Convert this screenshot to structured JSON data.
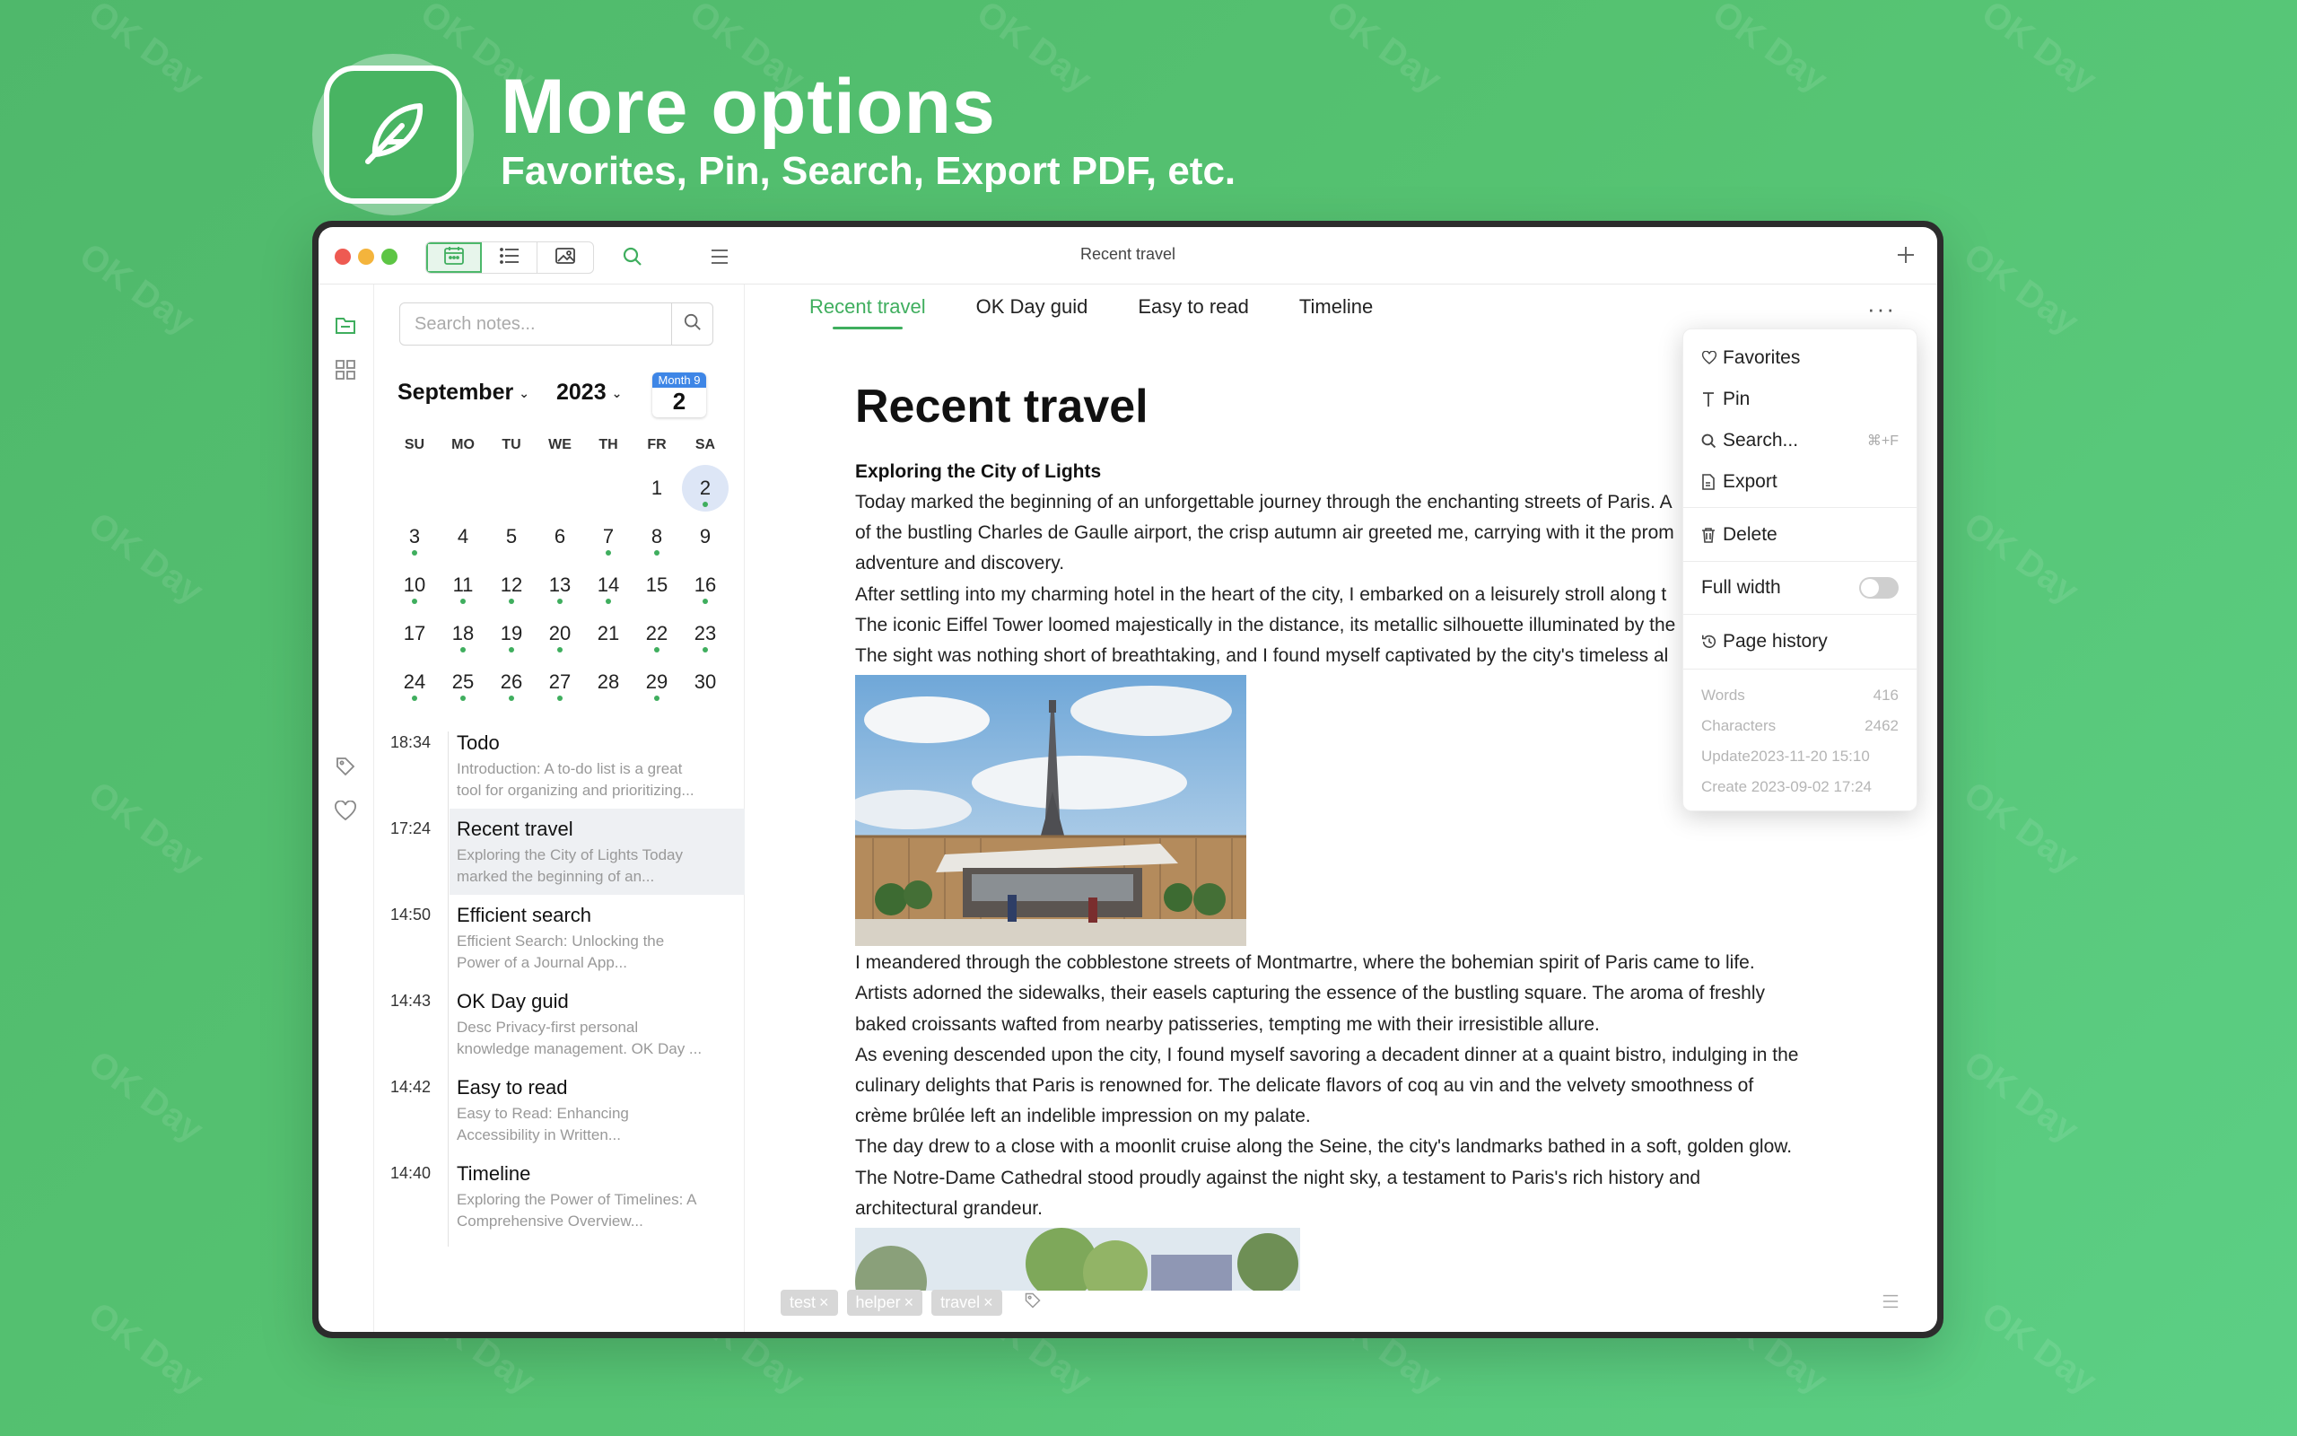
{
  "hero": {
    "title": "More options",
    "subtitle": "Favorites, Pin, Search, Export PDF, etc."
  },
  "watermark": "OK Day",
  "window": {
    "title": "Recent travel",
    "toolbar": {
      "view_calendar": "calendar-view-icon",
      "view_list": "list-view-icon",
      "view_gallery": "gallery-view-icon"
    }
  },
  "sidebar": {
    "search_placeholder": "Search notes...",
    "calendar": {
      "month": "September",
      "year": "2023",
      "today_month": "Month 9",
      "today_day": "2",
      "weekdays": [
        "SU",
        "MO",
        "TU",
        "WE",
        "TH",
        "FR",
        "SA"
      ],
      "leading_blanks": 5,
      "days": [
        "1",
        "2",
        "3",
        "4",
        "5",
        "6",
        "7",
        "8",
        "9",
        "10",
        "11",
        "12",
        "13",
        "14",
        "15",
        "16",
        "17",
        "18",
        "19",
        "20",
        "21",
        "22",
        "23",
        "24",
        "25",
        "26",
        "27",
        "28",
        "29",
        "30"
      ],
      "selected_day": "2",
      "days_with_notes": [
        "2",
        "3",
        "7",
        "8",
        "10",
        "11",
        "12",
        "13",
        "14",
        "16",
        "18",
        "19",
        "20",
        "22",
        "23",
        "24",
        "25",
        "26",
        "27",
        "29"
      ]
    },
    "notes": [
      {
        "time": "18:34",
        "title": "Todo",
        "desc1": "Introduction: A to-do list is a great",
        "desc2": "tool for organizing and prioritizing..."
      },
      {
        "time": "17:24",
        "title": "Recent travel",
        "desc1": "Exploring the City of Lights Today",
        "desc2": "marked the beginning of an..."
      },
      {
        "time": "14:50",
        "title": "Efficient search",
        "desc1": "Efficient Search: Unlocking the",
        "desc2": "Power of a Journal App..."
      },
      {
        "time": "14:43",
        "title": "OK Day guid",
        "desc1": "Desc Privacy-first personal",
        "desc2": "knowledge management. OK Day ..."
      },
      {
        "time": "14:42",
        "title": "Easy to read",
        "desc1": "Easy to Read: Enhancing",
        "desc2": "Accessibility in Written..."
      },
      {
        "time": "14:40",
        "title": "Timeline",
        "desc1": "Exploring the Power of Timelines: A",
        "desc2": "Comprehensive Overview..."
      }
    ]
  },
  "tabs": [
    "Recent travel",
    "OK Day guid",
    "Easy to read",
    "Timeline"
  ],
  "document": {
    "title": "Recent travel",
    "subheading": "Exploring the City of Lights",
    "para1": [
      "Today marked the beginning of an unforgettable journey through the enchanting streets of Paris. A",
      "of the bustling Charles de Gaulle airport, the crisp autumn air greeted me, carrying with it the prom",
      "adventure and discovery.",
      "After settling into my charming hotel in the heart of the city, I embarked on a leisurely stroll along t",
      "The iconic Eiffel Tower loomed majestically in the distance, its metallic silhouette illuminated by the",
      "The sight was nothing short of breathtaking, and I found myself captivated by the city's timeless al"
    ],
    "para2": [
      "I meandered through the cobblestone streets of Montmartre, where the bohemian spirit of Paris came to life.",
      "Artists adorned the sidewalks, their easels capturing the essence of the bustling square. The aroma of freshly",
      "baked croissants wafted from nearby patisseries, tempting me with their irresistible allure.",
      "As evening descended upon the city, I found myself savoring a decadent dinner at a quaint bistro, indulging in the",
      "culinary delights that Paris is renowned for. The delicate flavors of coq au vin and the velvety smoothness of",
      "crème brûlée left an indelible impression on my palate.",
      "The day drew to a close with a moonlit cruise along the Seine, the city's landmarks bathed in a soft, golden glow.",
      "The Notre-Dame Cathedral stood proudly against the night sky, a testament to Paris's rich history and",
      "architectural grandeur."
    ],
    "tags": [
      "test",
      "helper",
      "travel"
    ]
  },
  "menu": {
    "favorites": "Favorites",
    "pin": "Pin",
    "search": "Search...",
    "search_shortcut": "⌘+F",
    "export": "Export",
    "delete": "Delete",
    "full_width": "Full width",
    "full_width_on": false,
    "page_history": "Page history",
    "stats": {
      "words_label": "Words",
      "words": "416",
      "chars_label": "Characters",
      "chars": "2462",
      "update_label": "Update",
      "update": "2023-11-20 15:10",
      "create_label": "Create",
      "create": "2023-09-02 17:24"
    }
  },
  "colors": {
    "accent": "#3fae5e",
    "background": "#55c271"
  }
}
